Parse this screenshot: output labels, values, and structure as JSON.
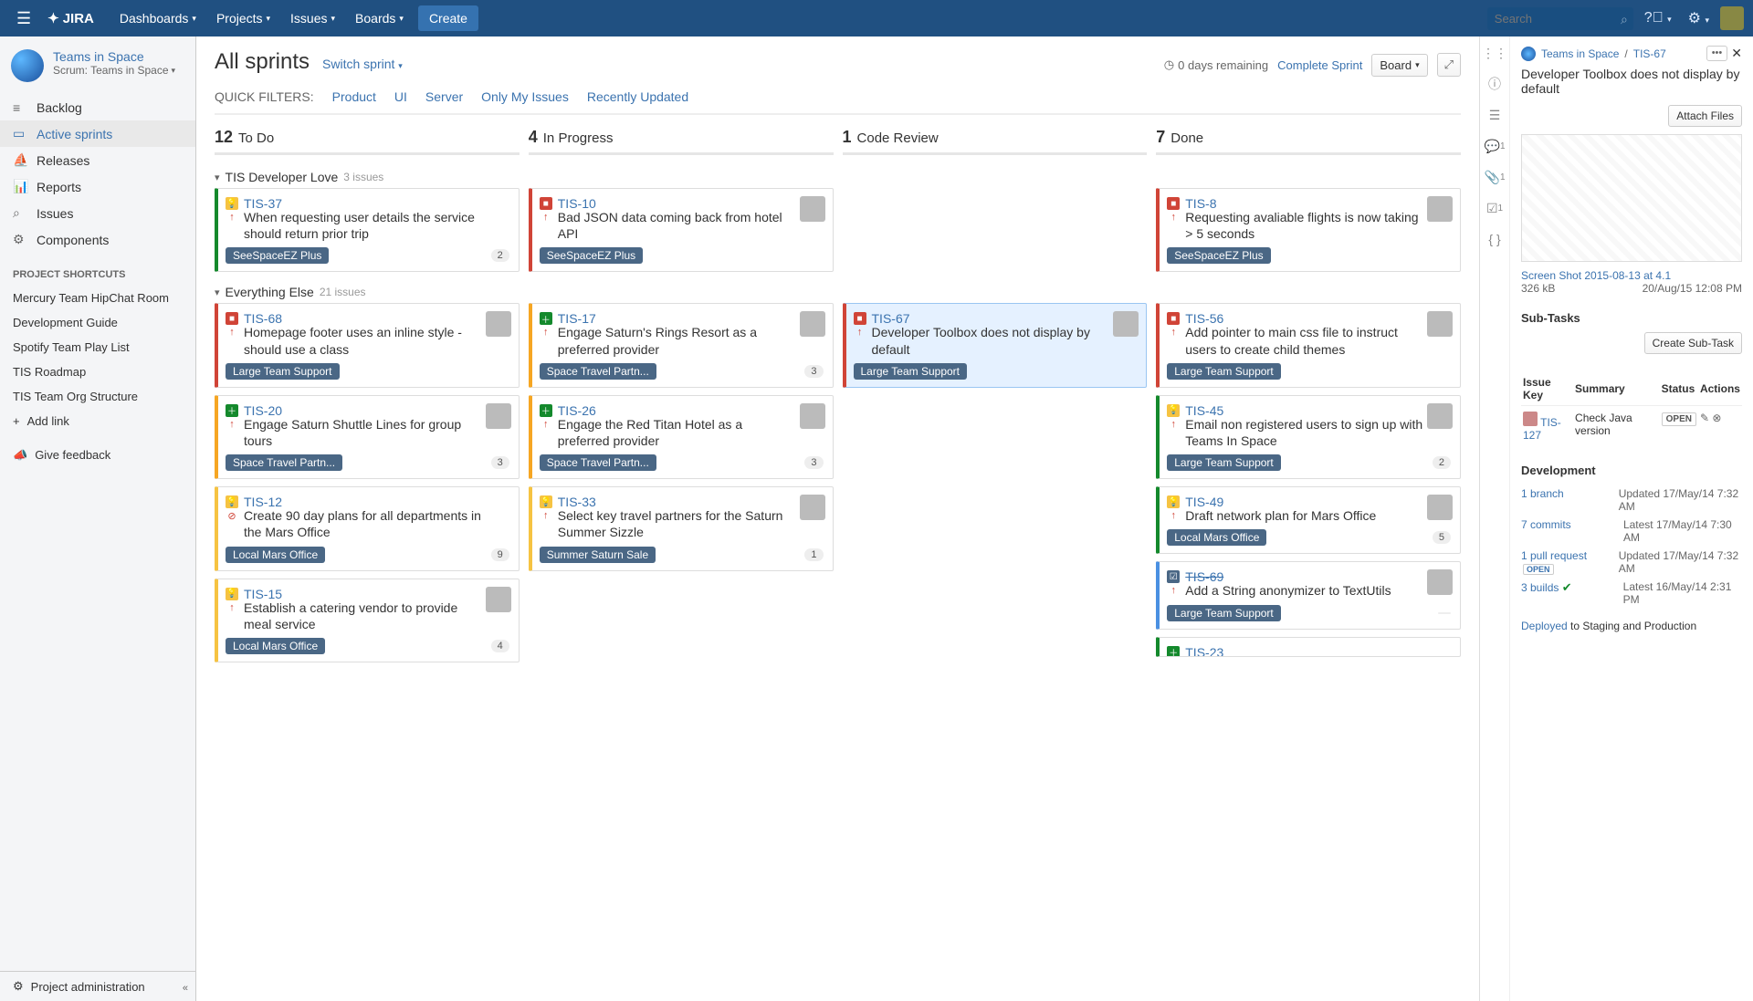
{
  "topbar": {
    "logo": "JIRA",
    "nav": [
      "Dashboards",
      "Projects",
      "Issues",
      "Boards"
    ],
    "create": "Create",
    "search_ph": "Search"
  },
  "project": {
    "name": "Teams in Space",
    "type": "Scrum: Teams in Space"
  },
  "sidenav": [
    {
      "icon": "backlog",
      "label": "Backlog"
    },
    {
      "icon": "board",
      "label": "Active sprints",
      "active": true
    },
    {
      "icon": "ship",
      "label": "Releases"
    },
    {
      "icon": "chart",
      "label": "Reports"
    },
    {
      "icon": "search",
      "label": "Issues"
    },
    {
      "icon": "comp",
      "label": "Components"
    }
  ],
  "shortcuts_title": "PROJECT SHORTCUTS",
  "shortcuts": [
    "Mercury Team HipChat Room",
    "Development Guide",
    "Spotify Team Play List",
    "TIS Roadmap",
    "TIS Team Org Structure"
  ],
  "add_link": "Add link",
  "give_feedback": "Give feedback",
  "proj_admin": "Project administration",
  "board": {
    "title": "All sprints",
    "switch": "Switch sprint",
    "remaining": "0 days remaining",
    "complete": "Complete Sprint",
    "board_btn": "Board",
    "filters_label": "QUICK FILTERS:",
    "filters": [
      "Product",
      "UI",
      "Server",
      "Only My Issues",
      "Recently Updated"
    ],
    "columns": [
      {
        "count": 12,
        "name": "To Do"
      },
      {
        "count": 4,
        "name": "In Progress"
      },
      {
        "count": 1,
        "name": "Code Review"
      },
      {
        "count": 7,
        "name": "Done"
      }
    ],
    "swimlanes": [
      {
        "name": "TIS Developer Love",
        "count": "3 issues"
      },
      {
        "name": "Everything Else",
        "count": "21 issues"
      }
    ],
    "cards": {
      "lane0": {
        "todo": [
          {
            "key": "TIS-37",
            "type": "idea",
            "prio": "high",
            "bl": "green",
            "summary": "When requesting user details the service should return prior trip",
            "epic": "SeeSpaceEZ Plus",
            "epicc": "blue",
            "badge": "2"
          }
        ],
        "prog": [
          {
            "key": "TIS-10",
            "type": "bug",
            "prio": "high",
            "bl": "red",
            "summary": "Bad JSON data coming back from hotel API",
            "epic": "SeeSpaceEZ Plus",
            "epicc": "blue",
            "avatar": true
          }
        ],
        "rev": [],
        "done": [
          {
            "key": "TIS-8",
            "type": "bug",
            "prio": "high",
            "bl": "red",
            "summary": "Requesting avaliable flights is now taking > 5 seconds",
            "epic": "SeeSpaceEZ Plus",
            "epicc": "blue",
            "avatar": true
          }
        ]
      },
      "lane1": {
        "todo": [
          {
            "key": "TIS-68",
            "type": "bug",
            "prio": "high",
            "bl": "red",
            "summary": "Homepage footer uses an inline style - should use a class",
            "epic": "Large Team Support",
            "epicc": "blue",
            "avatar": true
          },
          {
            "key": "TIS-20",
            "type": "story",
            "prio": "high",
            "bl": "orange",
            "summary": "Engage Saturn Shuttle Lines for group tours",
            "epic": "Space Travel Partn...",
            "epicc": "red",
            "badge": "3",
            "avatar": true
          },
          {
            "key": "TIS-12",
            "type": "idea",
            "prio": "block",
            "bl": "yellow",
            "summary": "Create 90 day plans for all departments in the Mars Office",
            "epic": "Local Mars Office",
            "epicc": "purple",
            "badge": "9"
          },
          {
            "key": "TIS-15",
            "type": "idea",
            "prio": "high",
            "bl": "yellow",
            "summary": "Establish a catering vendor to provide meal service",
            "epic": "Local Mars Office",
            "epicc": "purple",
            "badge": "4",
            "avatar": true
          }
        ],
        "prog": [
          {
            "key": "TIS-17",
            "type": "story",
            "prio": "high",
            "bl": "orange",
            "summary": "Engage Saturn's Rings Resort as a preferred provider",
            "epic": "Space Travel Partn...",
            "epicc": "red",
            "badge": "3",
            "avatar": true
          },
          {
            "key": "TIS-26",
            "type": "story",
            "prio": "high",
            "bl": "orange",
            "summary": "Engage the Red Titan Hotel as a preferred provider",
            "epic": "Space Travel Partn...",
            "epicc": "red",
            "badge": "3",
            "avatar": true
          },
          {
            "key": "TIS-33",
            "type": "idea",
            "prio": "high",
            "bl": "yellow",
            "summary": "Select key travel partners for the Saturn Summer Sizzle",
            "epic": "Summer Saturn Sale",
            "epicc": "yellow",
            "badge": "1",
            "avatar": true
          }
        ],
        "rev": [
          {
            "key": "TIS-67",
            "type": "bug",
            "prio": "high",
            "bl": "red",
            "summary": "Developer Toolbox does not display by default",
            "epic": "Large Team Support",
            "epicc": "blue",
            "sel": true,
            "avatar": true
          }
        ],
        "done": [
          {
            "key": "TIS-56",
            "type": "bug",
            "prio": "high",
            "bl": "red",
            "summary": "Add pointer to main css file to instruct users to create child themes",
            "epic": "Large Team Support",
            "epicc": "blue",
            "avatar": true
          },
          {
            "key": "TIS-45",
            "type": "idea",
            "prio": "high",
            "bl": "green",
            "summary": "Email non registered users to sign up with Teams In Space",
            "epic": "Large Team Support",
            "epicc": "blue",
            "badge": "2",
            "avatar": true
          },
          {
            "key": "TIS-49",
            "type": "idea",
            "prio": "high",
            "bl": "green",
            "summary": "Draft network plan for Mars Office",
            "epic": "Local Mars Office",
            "epicc": "purple",
            "badge": "5",
            "avatar": true
          },
          {
            "key": "TIS-69",
            "type": "task",
            "prio": "high",
            "bl": "blue",
            "summary": "Add a String anonymizer to TextUtils",
            "epic": "Large Team Support",
            "epicc": "blue",
            "badge": " ",
            "avatar": true,
            "strike": true
          },
          {
            "key": "TIS-23",
            "type": "story",
            "prio": "",
            "bl": "green",
            "summary": "",
            "epic": "",
            "epicc": "",
            "partial": true
          }
        ]
      }
    }
  },
  "detail": {
    "crumb_project": "Teams in Space",
    "crumb_key": "TIS-67",
    "title": "Developer Toolbox does not display by default",
    "attach_btn": "Attach Files",
    "thumb_name": "Screen Shot 2015-08-13 at 4.1",
    "thumb_size": "326 kB",
    "thumb_date": "20/Aug/15 12:08 PM",
    "subtasks_title": "Sub-Tasks",
    "create_sub": "Create Sub-Task",
    "table_h": [
      "Issue Key",
      "Summary",
      "Status",
      "Actions"
    ],
    "subtask": {
      "key": "TIS-127",
      "summary": "Check Java version",
      "status": "OPEN"
    },
    "dev_title": "Development",
    "dev": [
      {
        "l": "1 branch",
        "r": "Updated 17/May/14 7:32 AM"
      },
      {
        "l": "7 commits",
        "r": "Latest 17/May/14 7:30 AM"
      },
      {
        "l": "1 pull request",
        "badge": "OPEN",
        "r": "Updated 17/May/14 7:32 AM"
      },
      {
        "l": "3 builds",
        "check": true,
        "r": "Latest 16/May/14 2:31 PM"
      }
    ],
    "deployed_link": "Deployed",
    "deployed_text": " to Staging and Production"
  }
}
